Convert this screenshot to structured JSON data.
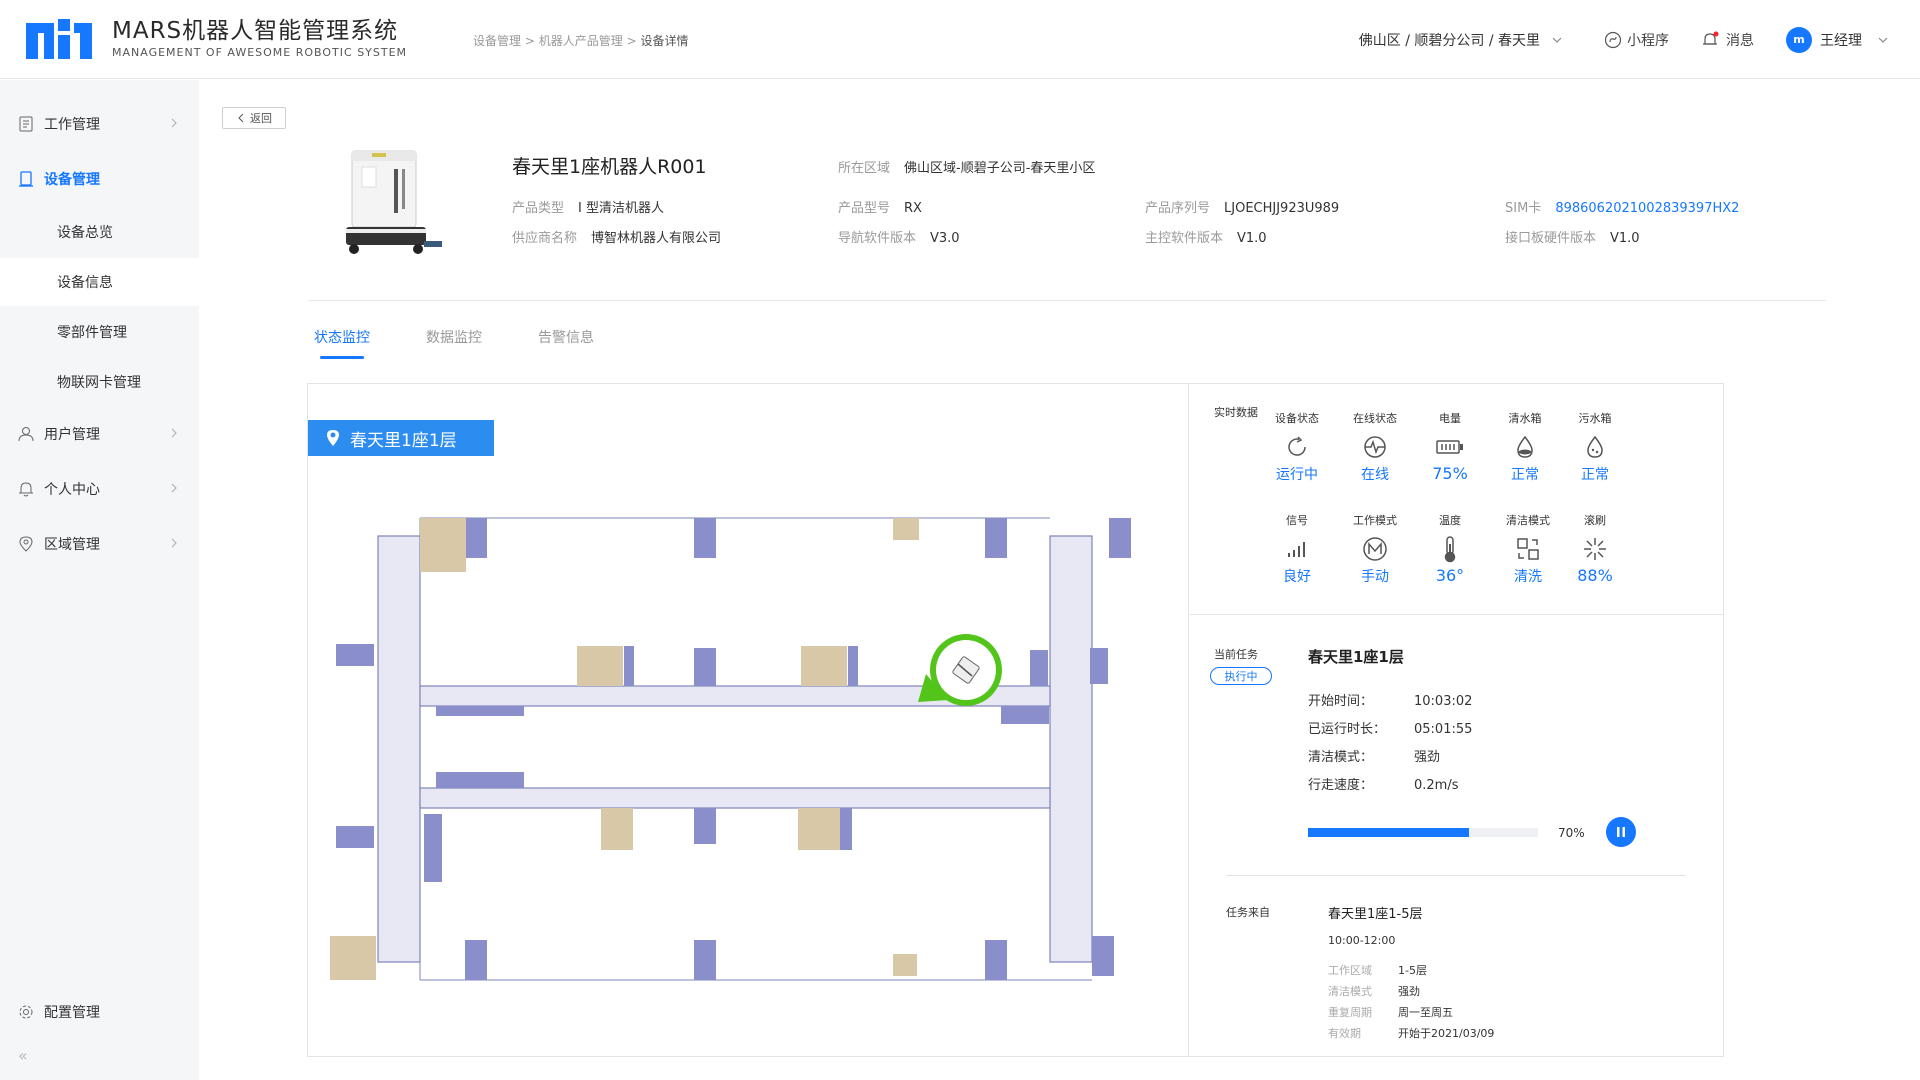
{
  "header": {
    "logo_title": "MARS机器人智能管理系统",
    "logo_sub": "MANAGEMENT OF AWESOME ROBOTIC SYSTEM",
    "breadcrumb": [
      "设备管理",
      "机器人产品管理",
      "设备详情"
    ],
    "breadcrumb_sep": ">",
    "location": "佛山区 / 顺碧分公司 / 春天里",
    "mini_program": "小程序",
    "messages": "消息",
    "avatar_text": "m",
    "user_name": "王经理"
  },
  "sidebar": {
    "items": [
      {
        "label": "工作管理"
      },
      {
        "label": "设备管理"
      },
      {
        "label": "用户管理"
      },
      {
        "label": "个人中心"
      },
      {
        "label": "区域管理"
      }
    ],
    "sub_items": [
      {
        "label": "设备总览"
      },
      {
        "label": "设备信息"
      },
      {
        "label": "零部件管理"
      },
      {
        "label": "物联网卡管理"
      }
    ],
    "config": "配置管理",
    "collapse": "«"
  },
  "back_label": "返回",
  "device": {
    "name": "春天里1座机器人R001",
    "region_key": "所在区域",
    "region_val": "佛山区域-顺碧子公司-春天里小区",
    "type_key": "产品类型",
    "type_val": "I 型清洁机器人",
    "supplier_key": "供应商名称",
    "supplier_val": "博智林机器人有限公司",
    "model_key": "产品型号",
    "model_val": "RX",
    "nav_key": "导航软件版本",
    "nav_val": "V3.0",
    "serial_key": "产品序列号",
    "serial_val": "LJOECHJJ923U989",
    "main_key": "主控软件版本",
    "main_val": "V1.0",
    "sim_key": "SIM卡",
    "sim_val": "8986062021002839397HX2",
    "iface_key": "接口板硬件版本",
    "iface_val": "V1.0"
  },
  "tabs": [
    {
      "label": "状态监控"
    },
    {
      "label": "数据监控"
    },
    {
      "label": "告警信息"
    }
  ],
  "map": {
    "floor": "春天里1座1层"
  },
  "realtime": {
    "title": "实时数据",
    "stats": [
      {
        "label": "设备状态",
        "value": "运行中",
        "icon": "refresh-icon"
      },
      {
        "label": "在线状态",
        "value": "在线",
        "icon": "pulse-icon"
      },
      {
        "label": "电量",
        "value": "75%",
        "icon": "battery-icon"
      },
      {
        "label": "清水箱",
        "value": "正常",
        "icon": "water-drop-icon"
      },
      {
        "label": "污水箱",
        "value": "正常",
        "icon": "dirty-drop-icon"
      },
      {
        "label": "信号",
        "value": "良好",
        "icon": "signal-icon"
      },
      {
        "label": "工作模式",
        "value": "手动",
        "icon": "mode-m-icon"
      },
      {
        "label": "温度",
        "value": "36°",
        "icon": "thermometer-icon"
      },
      {
        "label": "清洁模式",
        "value": "清洗",
        "icon": "clean-mode-icon"
      },
      {
        "label": "滚刷",
        "value": "88%",
        "icon": "brush-icon"
      }
    ]
  },
  "task": {
    "label": "当前任务",
    "badge": "执行中",
    "name": "春天里1座1层",
    "start_key": "开始时间：",
    "start_val": "10:03:02",
    "run_key": "已运行时长：",
    "run_val": "05:01:55",
    "mode_key": "清洁模式：",
    "mode_val": "强劲",
    "speed_key": "行走速度：",
    "speed_val": "0.2m/s",
    "progress": 0.7,
    "progress_text": "70%"
  },
  "source": {
    "label": "任务来自",
    "name": "春天里1座1-5层",
    "time": "10:00-12:00",
    "rows": [
      {
        "k": "工作区域",
        "v": "1-5层"
      },
      {
        "k": "清洁模式",
        "v": "强劲"
      },
      {
        "k": "重复周期",
        "v": "周一至周五"
      },
      {
        "k": "有效期",
        "v": "开始于2021/03/09"
      }
    ]
  },
  "colors": {
    "accent": "#1677ff",
    "floor_tag": "#2d8cf0",
    "robot_marker": "#52c41a",
    "corridor": "#e8e8f4",
    "furniture_purple": "#8a8fcc",
    "furniture_tan": "#d8c8a8"
  }
}
